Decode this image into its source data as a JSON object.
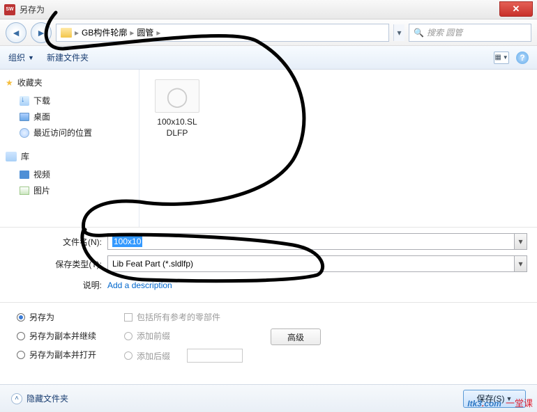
{
  "window": {
    "title": "另存为"
  },
  "nav": {
    "crumb1": "GB构件轮廓",
    "crumb2": "圆管",
    "search_placeholder": "搜索 圆管"
  },
  "toolbar": {
    "organize": "组织",
    "newfolder": "新建文件夹"
  },
  "sidebar": {
    "favorites": "收藏夹",
    "downloads": "下载",
    "desktop": "桌面",
    "recent": "最近访问的位置",
    "library": "库",
    "video": "视频",
    "pictures": "图片"
  },
  "files": {
    "item1_line1": "100x10.SL",
    "item1_line2": "DLFP"
  },
  "form": {
    "filename_label": "文件名(N):",
    "filename_value": "100x10",
    "filetype_label": "保存类型(T):",
    "filetype_value": "Lib Feat Part (*.sldlfp)",
    "desc_label": "说明:",
    "desc_link": "Add a description"
  },
  "options": {
    "saveas": "另存为",
    "saveas_copy_continue": "另存为副本并继续",
    "saveas_copy_open": "另存为副本并打开",
    "include_refs": "包括所有参考的零部件",
    "add_prefix": "添加前缀",
    "add_suffix": "添加后缀",
    "advanced": "高级"
  },
  "bottom": {
    "hide_folders": "隐藏文件夹",
    "save": "保存(S)"
  },
  "watermark": {
    "brand": "Itk3",
    "dot": ".",
    "com": "com",
    "cn": "一堂课"
  }
}
